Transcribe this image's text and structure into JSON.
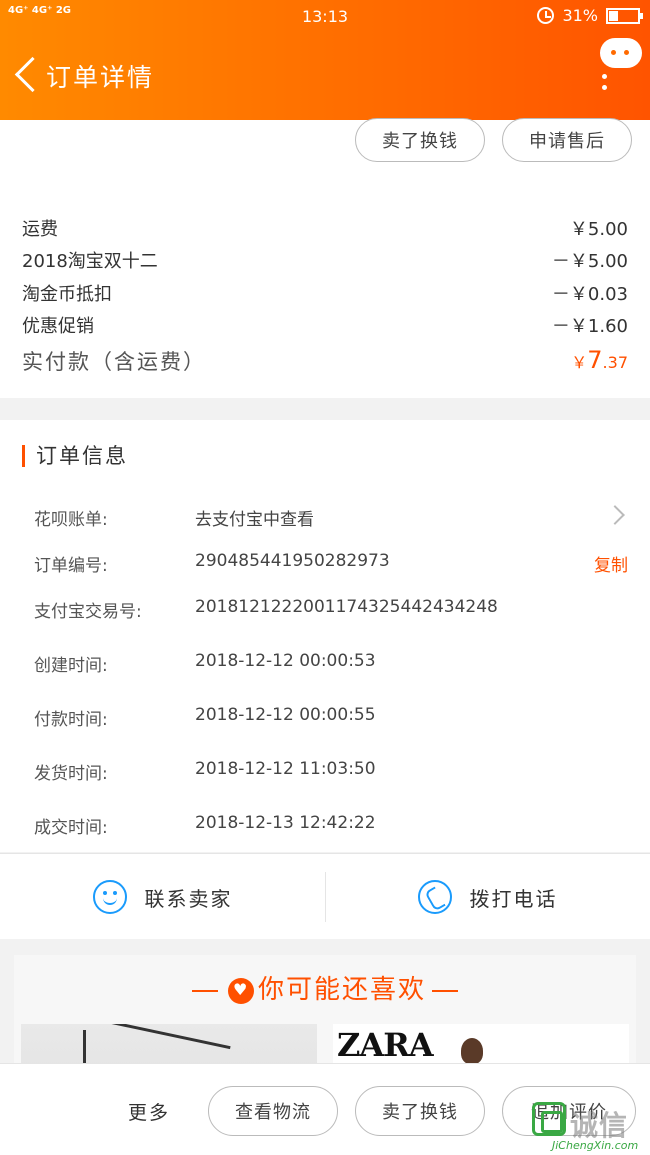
{
  "status_bar": {
    "network": "4G⁺ 4G⁺ 2G",
    "time": "13:13",
    "battery": "31%"
  },
  "header": {
    "title": "订单详情"
  },
  "actions_top": {
    "sell": "卖了换钱",
    "after_sale": "申请售后"
  },
  "fees": [
    {
      "label": "运费",
      "value": "￥5.00"
    },
    {
      "label": "2018淘宝双十二",
      "value": "－￥5.00"
    },
    {
      "label": "淘金币抵扣",
      "value": "－￥0.03"
    },
    {
      "label": "优惠促销",
      "value": "－￥1.60"
    }
  ],
  "total": {
    "label": "实付款（含运费）",
    "currency": "￥",
    "integer": "7",
    "decimal": ".37"
  },
  "order_info": {
    "title": "订单信息",
    "rows": [
      {
        "key": "花呗账单:",
        "value": "去支付宝中查看"
      },
      {
        "key": "订单编号:",
        "value": "290485441950282973",
        "action": "复制"
      },
      {
        "key": "支付宝交易号:",
        "value": "2018121222001174325442434248"
      },
      {
        "key": "创建时间:",
        "value": "2018-12-12 00:00:53"
      },
      {
        "key": "付款时间:",
        "value": "2018-12-12 00:00:55"
      },
      {
        "key": "发货时间:",
        "value": "2018-12-12 11:03:50"
      },
      {
        "key": "成交时间:",
        "value": "2018-12-13 12:42:22"
      }
    ]
  },
  "contact": {
    "seller": "联系卖家",
    "call": "拨打电话"
  },
  "recommend": {
    "title": "你可能还喜欢",
    "brand": "ZARA"
  },
  "bottom_bar": {
    "more": "更多",
    "logistics": "查看物流",
    "sell": "卖了换钱",
    "review": "追加评价"
  },
  "watermark": {
    "text": "诚信",
    "url": "JiChengXin.com"
  },
  "colors": {
    "accent": "#ff5000",
    "header_start": "#ff8a00",
    "header_end": "#ff5400",
    "icon_blue": "#1a9bfc"
  }
}
